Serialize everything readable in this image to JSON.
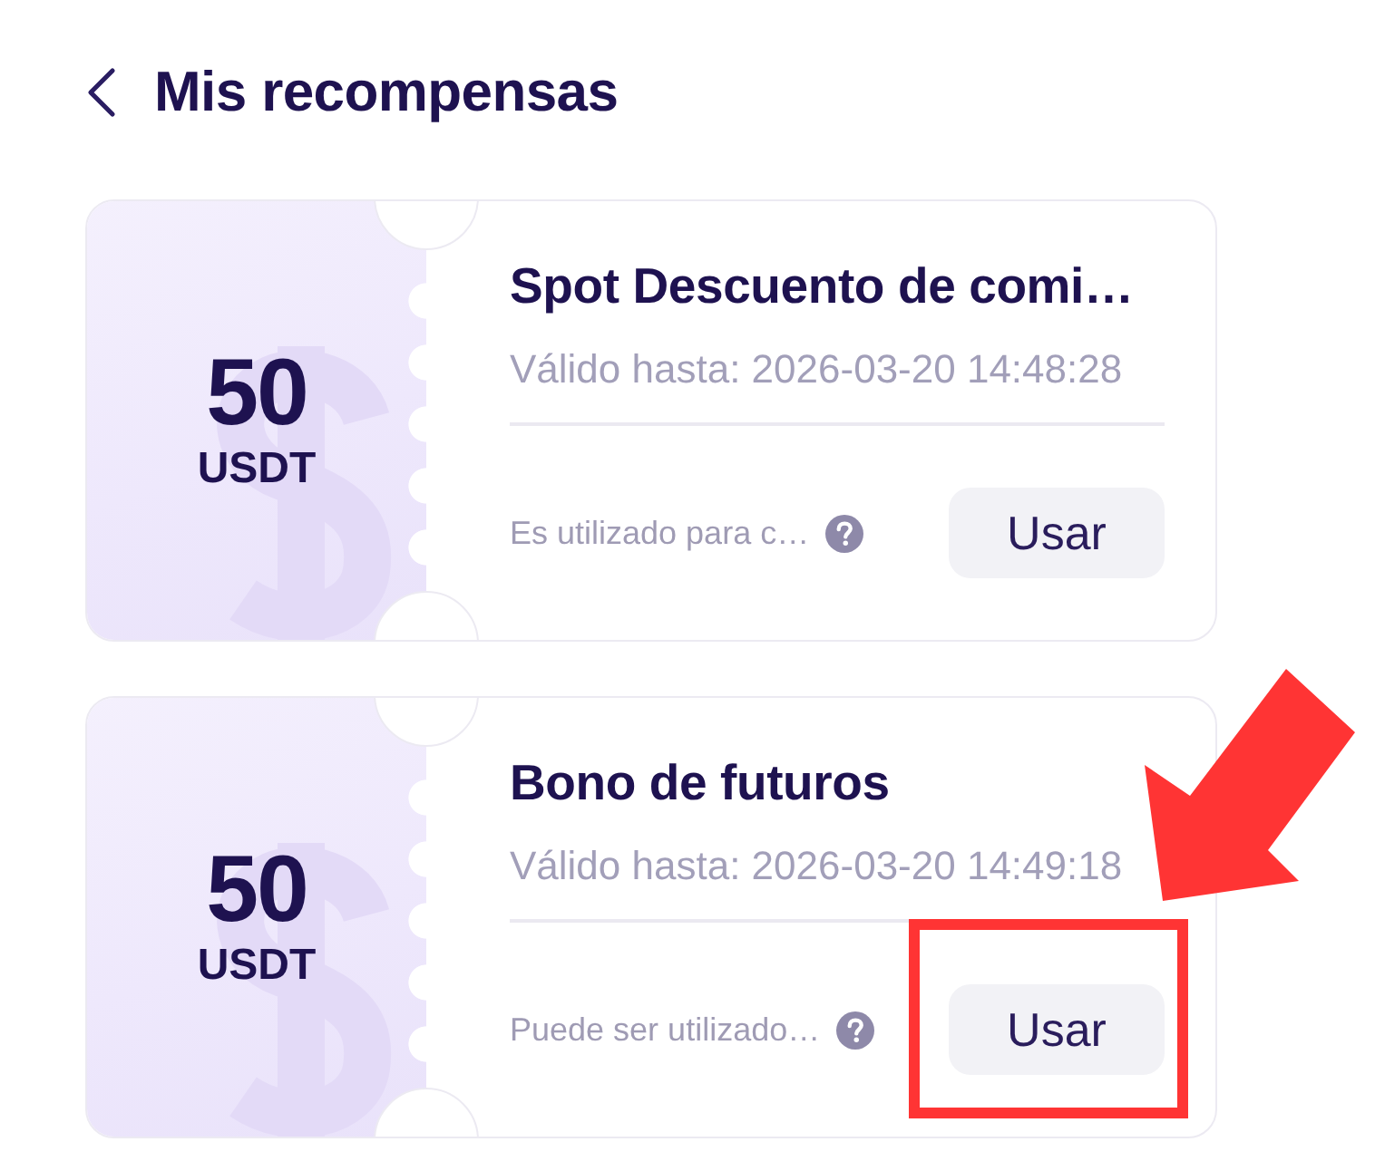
{
  "header": {
    "title": "Mis recompensas"
  },
  "coupons": [
    {
      "amount": "50",
      "currency": "USDT",
      "title": "Spot Descuento de comi…",
      "valid_until": "Válido hasta: 2026-03-20 14:48:28",
      "usage": "Es utilizado para c…",
      "button": "Usar",
      "highlighted": false
    },
    {
      "amount": "50",
      "currency": "USDT",
      "title": "Bono de futuros",
      "valid_until": "Válido hasta: 2026-03-20 14:49:18",
      "usage": "Puede ser utilizado…",
      "button": "Usar",
      "highlighted": true
    }
  ]
}
